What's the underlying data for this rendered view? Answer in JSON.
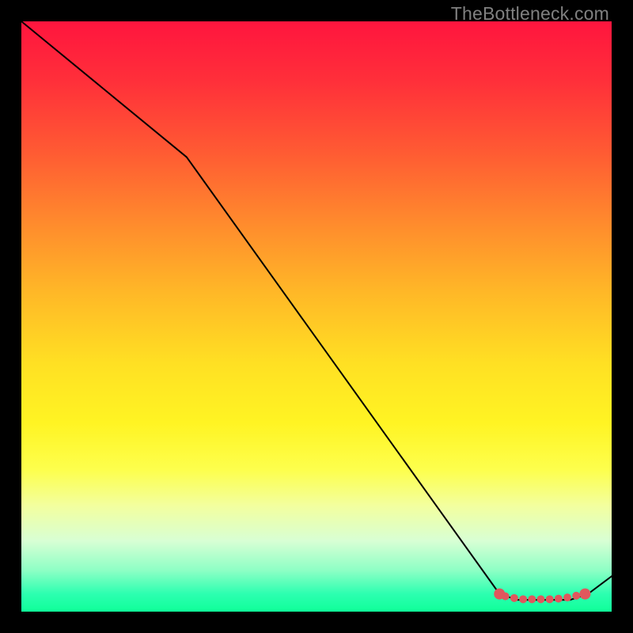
{
  "watermark": "TheBottleneck.com",
  "chart_data": {
    "type": "line",
    "title": "",
    "xlabel": "",
    "ylabel": "",
    "x_range": [
      0,
      100
    ],
    "y_range": [
      0,
      100
    ],
    "series": [
      {
        "name": "curve",
        "x": [
          0,
          28,
          81,
          84,
          87,
          90,
          93,
          96,
          100
        ],
        "y": [
          100,
          77,
          3,
          2,
          2,
          2,
          2,
          3,
          6
        ]
      }
    ],
    "markers": {
      "name": "highlight-points",
      "color": "#e0575d",
      "points": [
        {
          "x": 81,
          "y": 3,
          "r": 7
        },
        {
          "x": 82,
          "y": 2.6,
          "r": 5
        },
        {
          "x": 83.5,
          "y": 2.3,
          "r": 5
        },
        {
          "x": 85,
          "y": 2.1,
          "r": 5
        },
        {
          "x": 86.5,
          "y": 2.1,
          "r": 5
        },
        {
          "x": 88,
          "y": 2.1,
          "r": 5
        },
        {
          "x": 89.5,
          "y": 2.1,
          "r": 5
        },
        {
          "x": 91,
          "y": 2.2,
          "r": 5
        },
        {
          "x": 92.5,
          "y": 2.4,
          "r": 5
        },
        {
          "x": 94,
          "y": 2.7,
          "r": 5
        },
        {
          "x": 95.5,
          "y": 3.0,
          "r": 7
        }
      ]
    },
    "background_gradient": {
      "top_color": "#ff153e",
      "bottom_color": "#0fff99"
    }
  }
}
